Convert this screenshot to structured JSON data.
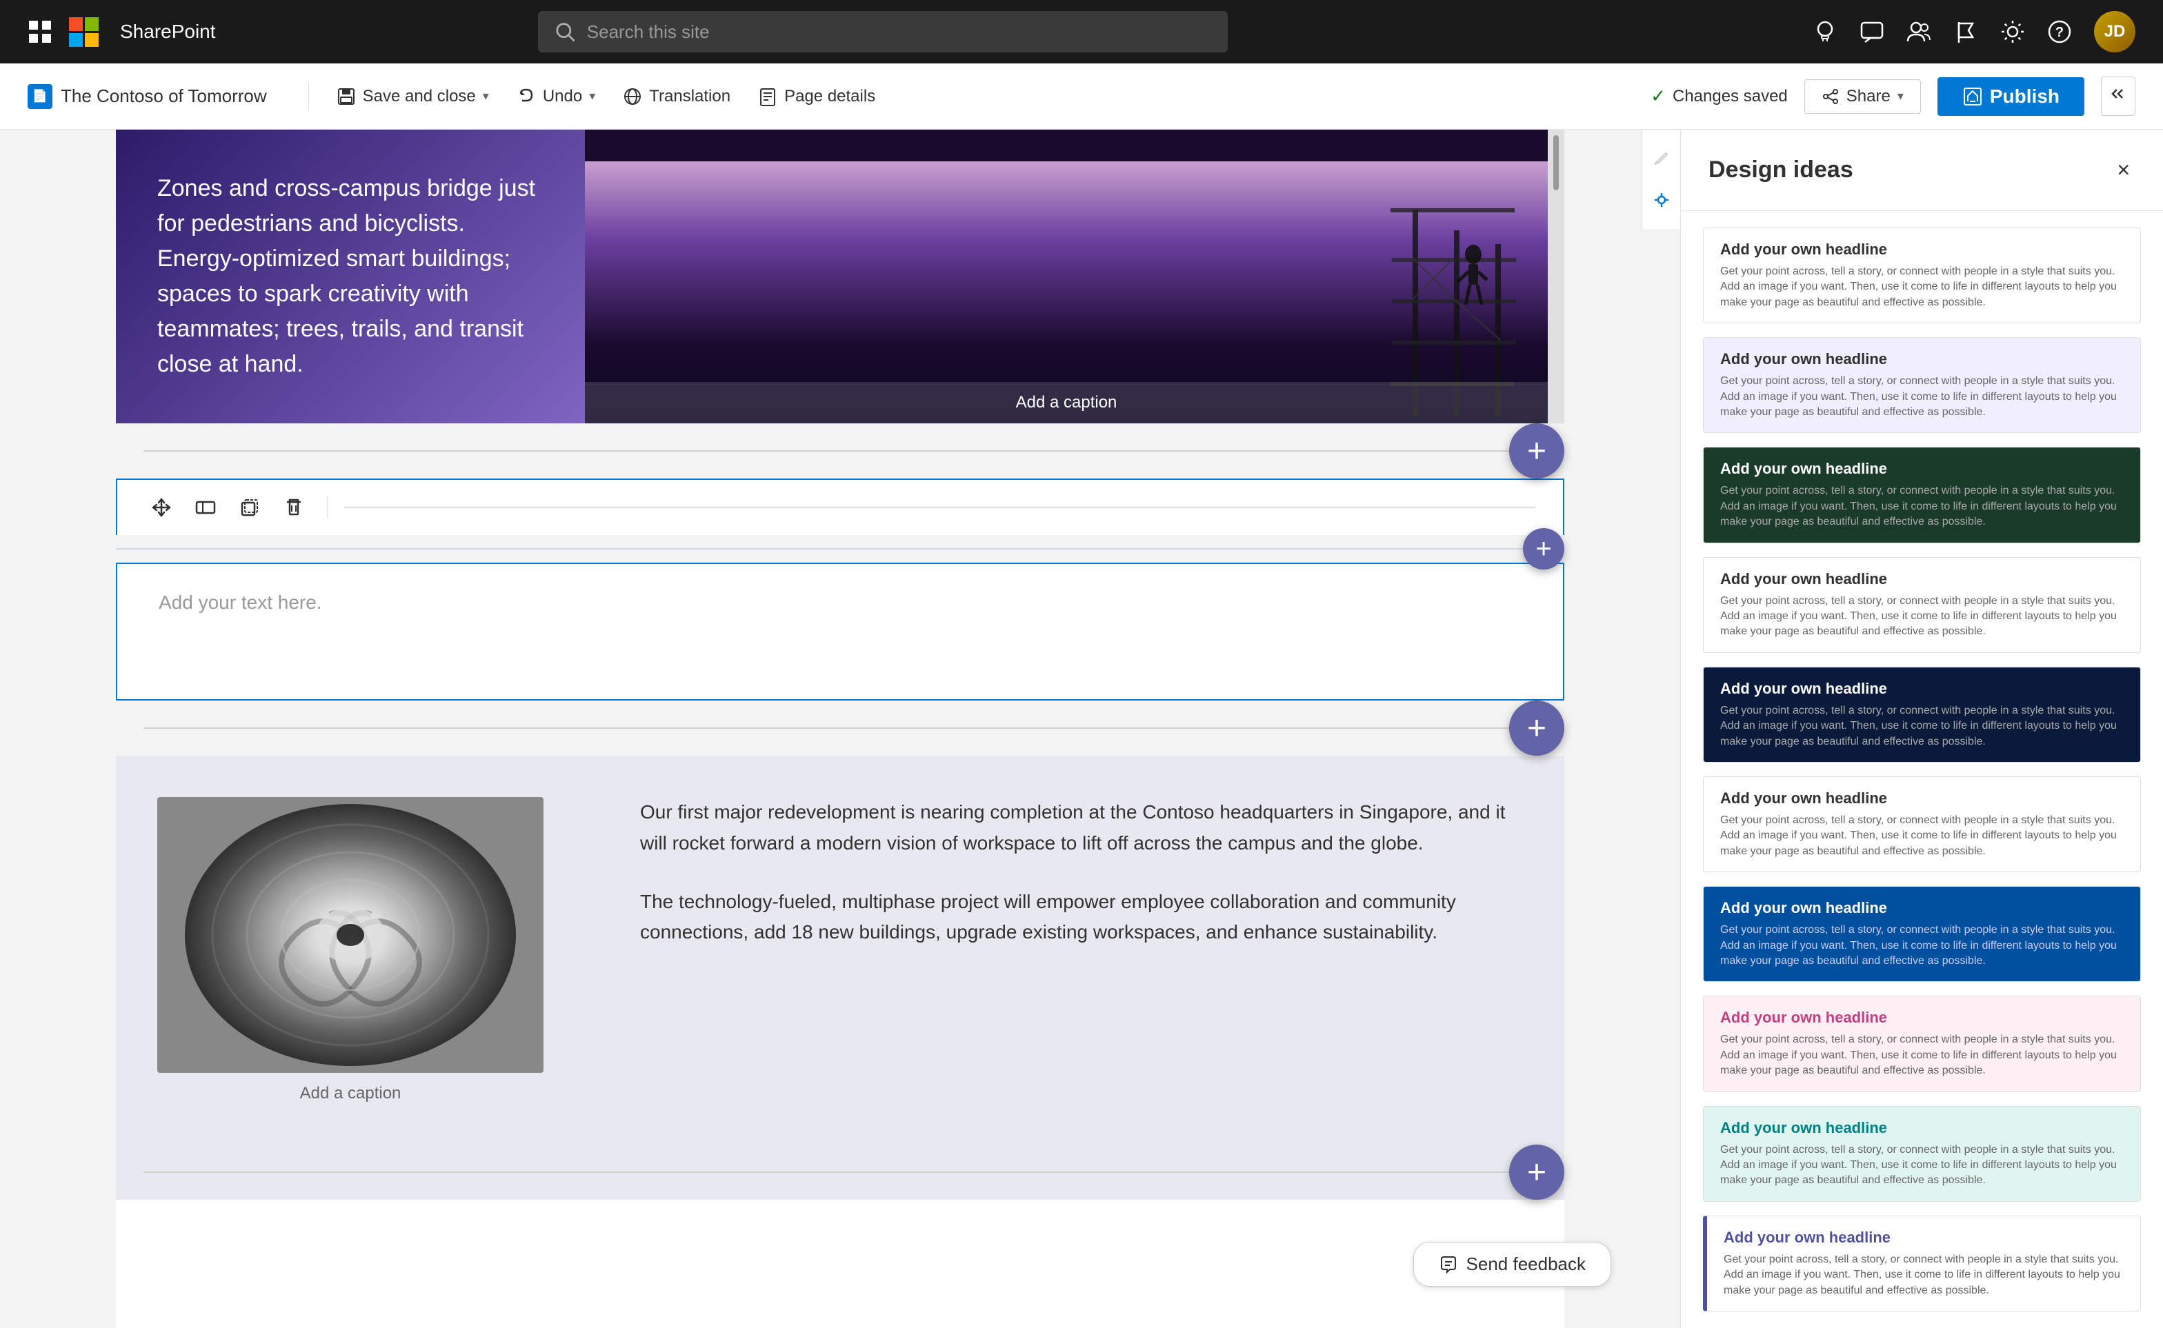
{
  "app": {
    "name": "SharePoint",
    "ms_logo_alt": "Microsoft logo"
  },
  "topnav": {
    "grid_icon": "⊞",
    "search_placeholder": "Search this site",
    "icons": [
      "💡",
      "💬",
      "👥",
      "🚩",
      "⚙",
      "?"
    ],
    "avatar_initials": "JD"
  },
  "toolbar": {
    "breadcrumb_icon": "📄",
    "breadcrumb_text": "The Contoso of Tomorrow",
    "save_close_label": "Save and close",
    "undo_label": "Undo",
    "translation_label": "Translation",
    "page_details_label": "Page details",
    "changes_saved_label": "Changes saved",
    "share_label": "Share",
    "publish_label": "Publish"
  },
  "hero": {
    "left_text": "Zones and cross-campus bridge just for pedestrians and bicyclists. Energy-optimized smart buildings; spaces to spark creativity with teammates; trees, trails, and transit close at hand.",
    "caption_placeholder": "Add a caption"
  },
  "text_section": {
    "placeholder": "Add your text here."
  },
  "bottom_section": {
    "image_caption": "Add a caption",
    "paragraph1": "Our first major redevelopment is nearing completion at the Contoso headquarters in Singapore, and it will rocket forward a modern vision of workspace to lift off across the campus and the globe.",
    "paragraph2": "The technology-fueled, multiphase project will empower employee collaboration and community connections, add 18 new buildings, upgrade existing workspaces, and enhance sustainability."
  },
  "design_panel": {
    "title": "Design ideas",
    "close_label": "×",
    "cards": [
      {
        "headline": "Add your own headline",
        "body": "Get your point across, tell a story, or connect with people in a style that suits you. Add an image if you want. Then, use it come to life in different layouts to help you make your page as beautiful and effective as possible.",
        "style": "card-white"
      },
      {
        "headline": "Add your own headline",
        "body": "Get your point across, tell a story, or connect with people in a style that suits you. Add an image if you want. Then, use it come to life in different layouts to help you make your page as beautiful and effective as possible.",
        "style": "card-light-purple"
      },
      {
        "headline": "Add your own headline",
        "body": "Get your point across, tell a story, or connect with people in a style that suits you. Add an image if you want. Then, use it come to life in different layouts to help you make your page as beautiful and effective as possible.",
        "style": "card-dark-green"
      },
      {
        "headline": "Add your own headline",
        "body": "Get your point across, tell a story, or connect with people in a style that suits you. Add an image if you want. Then, use it come to life in different layouts to help you make your page as beautiful and effective as possible.",
        "style": "card-white2"
      },
      {
        "headline": "Add your own headline",
        "body": "Get your point across, tell a story, or connect with people in a style that suits you. Add an image if you want. Then, use it come to life in different layouts to help you make your page as beautiful and effective as possible.",
        "style": "card-blue-dark"
      },
      {
        "headline": "Add your own headline",
        "body": "Get your point across, tell a story, or connect with people in a style that suits you. Add an image if you want. Then, use it come to life in different layouts to help you make your page as beautiful and effective as possible.",
        "style": "card-white2"
      },
      {
        "headline": "Add your own headline",
        "body": "Get your point across, tell a story, or connect with people in a style that suits you. Add an image if you want. Then, use it come to life in different layouts to help you make your page as beautiful and effective as possible.",
        "style": "card-medium-blue"
      },
      {
        "headline": "Add your own headline",
        "body": "Get your point across, tell a story, or connect with people in a style that suits you. Add an image if you want. Then, use it come to life in different layouts to help you make your page as beautiful and effective as possible.",
        "style": "card-pink"
      },
      {
        "headline": "Add your own headline",
        "body": "Get your point across, tell a story, or connect with people in a style that suits you. Add an image if you want. Then, use it come to life in different layouts to help you make your page as beautiful and effective as possible.",
        "style": "card-teal-light"
      },
      {
        "headline": "Add your own headline",
        "body": "Get your point across, tell a story, or connect with people in a style that suits you. Add an image if you want. Then, use it come to life in different layouts to help you make your page as beautiful and effective as possible.",
        "style": "card-purple-outline"
      }
    ]
  },
  "feedback": {
    "label": "Send feedback"
  }
}
